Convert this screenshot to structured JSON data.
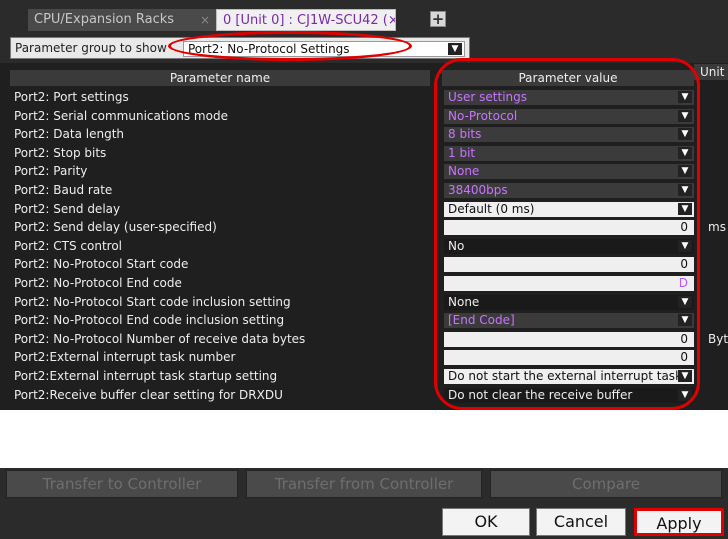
{
  "tabs": [
    {
      "label": "CPU/Expansion Racks",
      "close": "×",
      "active": false
    },
    {
      "label": "0 [Unit 0] : CJ1W-SCU42 (×",
      "close": "",
      "active": true
    }
  ],
  "add_tab_glyph": "+",
  "toolbar": {
    "group_label": "Parameter group to show",
    "group_value": "Port2: No-Protocol Settings",
    "dropdown_glyph": "▼"
  },
  "table": {
    "col_name": "Parameter name",
    "col_value": "Parameter value",
    "col_unit": "Unit",
    "rows": [
      {
        "name": "Port2: Port settings",
        "value": "User settings",
        "style": "dark",
        "dropdown": true,
        "unit": ""
      },
      {
        "name": "Port2: Serial communications mode",
        "value": "No-Protocol",
        "style": "dark",
        "dropdown": true,
        "unit": ""
      },
      {
        "name": "Port2: Data length",
        "value": "8 bits",
        "style": "dark",
        "dropdown": true,
        "unit": ""
      },
      {
        "name": "Port2: Stop bits",
        "value": "1 bit",
        "style": "dark",
        "dropdown": true,
        "unit": ""
      },
      {
        "name": "Port2: Parity",
        "value": "None",
        "style": "dark",
        "dropdown": true,
        "unit": ""
      },
      {
        "name": "Port2: Baud rate",
        "value": "38400bps",
        "style": "dark",
        "dropdown": true,
        "unit": ""
      },
      {
        "name": "Port2: Send delay",
        "value": "Default (0 ms)",
        "style": "light",
        "dropdown": true,
        "unit": ""
      },
      {
        "name": "Port2: Send delay (user-specified)",
        "value": "0",
        "style": "num",
        "dropdown": false,
        "unit": "ms"
      },
      {
        "name": "Port2: CTS control",
        "value": "No",
        "style": "dropsel",
        "dropdown": true,
        "unit": ""
      },
      {
        "name": "Port2: No-Protocol Start code",
        "value": "0",
        "style": "num",
        "dropdown": false,
        "unit": ""
      },
      {
        "name": "Port2: No-Protocol End code",
        "value": "D",
        "style": "numpurple",
        "dropdown": false,
        "unit": ""
      },
      {
        "name": "Port2: No-Protocol Start code inclusion setting",
        "value": "None",
        "style": "dropsel",
        "dropdown": true,
        "unit": ""
      },
      {
        "name": "Port2: No-Protocol End code inclusion setting",
        "value": "[End Code]",
        "style": "dark",
        "dropdown": true,
        "unit": ""
      },
      {
        "name": "Port2: No-Protocol Number of receive data bytes",
        "value": "0",
        "style": "num",
        "dropdown": false,
        "unit": "Byte"
      },
      {
        "name": "Port2:External interrupt task number",
        "value": "0",
        "style": "num",
        "dropdown": false,
        "unit": ""
      },
      {
        "name": "Port2:External interrupt task startup setting",
        "value": "Do not start the external interrupt task",
        "style": "light",
        "dropdown": true,
        "unit": ""
      },
      {
        "name": "Port2:Receive buffer clear setting for DRXDU",
        "value": "Do not clear the receive buffer",
        "style": "dropsel",
        "dropdown": true,
        "unit": ""
      }
    ]
  },
  "transfer_buttons": [
    "Transfer to Controller",
    "Transfer from Controller",
    "Compare"
  ],
  "dialog_buttons": {
    "ok": "OK",
    "cancel": "Cancel",
    "apply": "Apply"
  },
  "colors": {
    "highlight": "#e00000",
    "purple_value": "#c874ff"
  }
}
